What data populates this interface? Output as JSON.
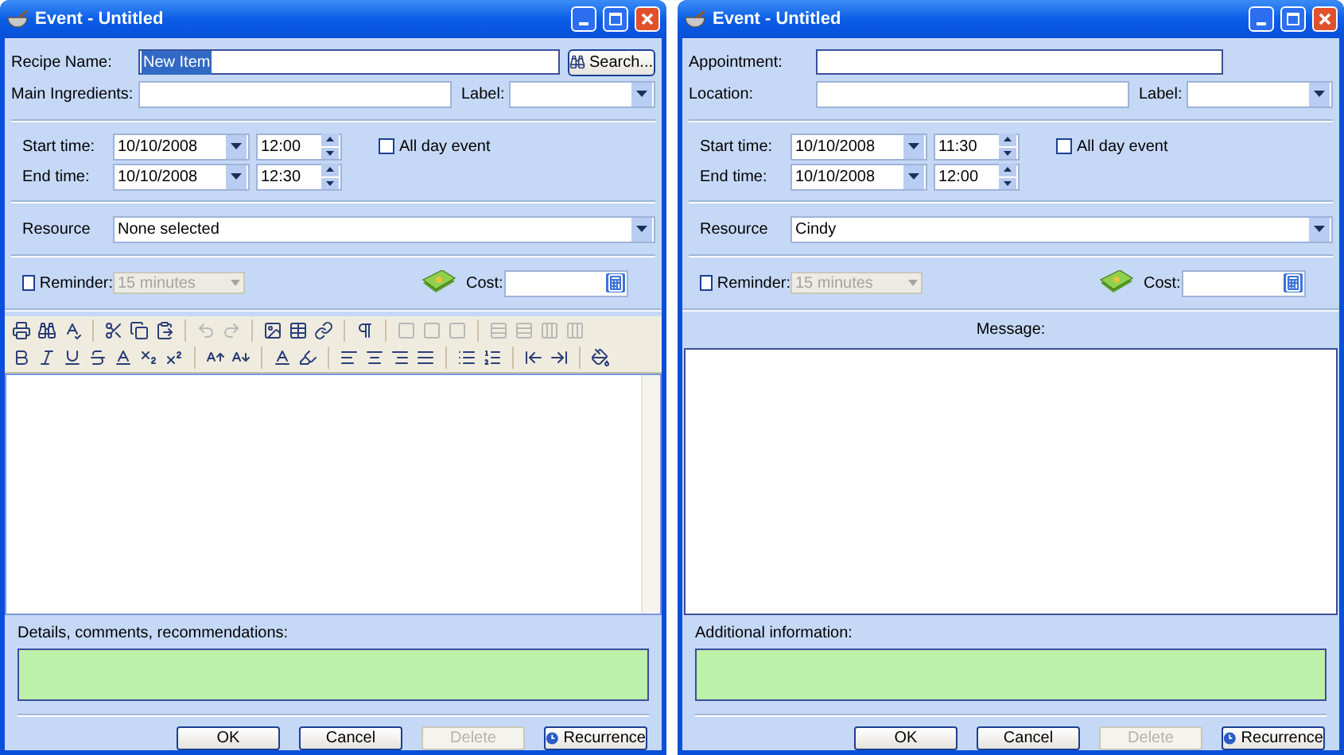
{
  "windows": [
    {
      "title": "Event - Untitled",
      "name_field": {
        "label": "Recipe Name:",
        "value": "New Item",
        "value_selected": true
      },
      "search_button": "Search...",
      "second_field": {
        "label": "Main Ingredients:"
      },
      "label_field": {
        "label": "Label:"
      },
      "start": {
        "label": "Start time:",
        "date": "10/10/2008",
        "time": "12:00"
      },
      "end": {
        "label": "End time:",
        "date": "10/10/2008",
        "time": "12:30"
      },
      "all_day": {
        "label": "All day event",
        "checked": false
      },
      "resource": {
        "label": "Resource",
        "value": "None selected"
      },
      "reminder": {
        "label": "Reminder:",
        "checked": false,
        "value": "15 minutes",
        "disabled": true
      },
      "cost": {
        "label": "Cost:"
      },
      "editor": {
        "kind": "rich"
      },
      "notes": {
        "label": "Details, comments, recommendations:"
      },
      "buttons": [
        {
          "label": "OK",
          "disabled": false,
          "kind": "plain"
        },
        {
          "label": "Cancel",
          "disabled": false,
          "kind": "plain"
        },
        {
          "label": "Delete",
          "disabled": true,
          "kind": "plain"
        },
        {
          "label": "Recurrence",
          "disabled": false,
          "kind": "recurrence"
        }
      ]
    },
    {
      "title": "Event - Untitled",
      "name_field": {
        "label": "Appointment:"
      },
      "second_field": {
        "label": "Location:"
      },
      "label_field": {
        "label": "Label:"
      },
      "start": {
        "label": "Start time:",
        "date": "10/10/2008",
        "time": "11:30"
      },
      "end": {
        "label": "End time:",
        "date": "10/10/2008",
        "time": "12:00"
      },
      "all_day": {
        "label": "All day event",
        "checked": false
      },
      "resource": {
        "label": "Resource",
        "value": "Cindy"
      },
      "reminder": {
        "label": "Reminder:",
        "checked": false,
        "value": "15 minutes",
        "disabled": true
      },
      "cost": {
        "label": "Cost:"
      },
      "editor": {
        "kind": "plain",
        "label": "Message:"
      },
      "notes": {
        "label": "Additional information:"
      },
      "buttons": [
        {
          "label": "OK",
          "disabled": false,
          "kind": "plain"
        },
        {
          "label": "Cancel",
          "disabled": false,
          "kind": "plain"
        },
        {
          "label": "Delete",
          "disabled": true,
          "kind": "plain"
        },
        {
          "label": "Recurrence",
          "disabled": false,
          "kind": "recurrence"
        }
      ]
    }
  ]
}
